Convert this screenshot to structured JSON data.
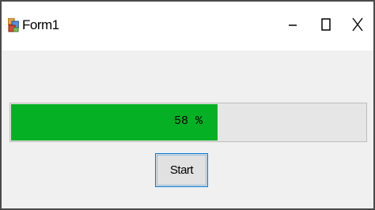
{
  "window": {
    "title": "Form1",
    "icon": "winforms-app-icon",
    "controls": {
      "minimize_icon": "minimize-icon",
      "maximize_icon": "maximize-icon",
      "close_icon": "close-icon"
    }
  },
  "progress": {
    "value_percent": 58,
    "label": "58 %",
    "fill_color": "#06b025",
    "track_color": "#e6e6e6"
  },
  "start_button": {
    "label": "Start",
    "accent_color": "#0078d7"
  }
}
